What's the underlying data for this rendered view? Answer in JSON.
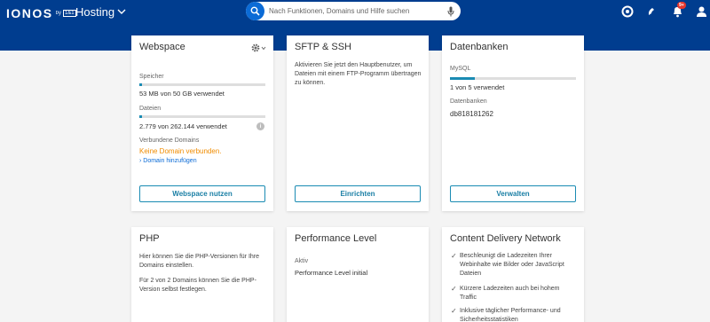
{
  "header": {
    "logo": "IONOS",
    "logo_by": "by",
    "logo_partner": "1&1",
    "product": "Hosting",
    "search_placeholder": "Nach Funktionen, Domains und Hilfe suchen",
    "notification_count": "9+",
    "color": "#003d8f"
  },
  "webspace": {
    "title": "Webspace",
    "storage_label": "Speicher",
    "storage_value": "53 MB von 50 GB verwendet",
    "storage_fraction": 0.001,
    "files_label": "Dateien",
    "files_value": "2.779 von 262.144 verwendet",
    "files_fraction": 0.0106,
    "domains_label": "Verbundene Domains",
    "domains_none": "Keine Domain verbunden.",
    "add_domain": "Domain hinzufügen",
    "button": "Webspace nutzen"
  },
  "sftp": {
    "title": "SFTP & SSH",
    "description": "Aktivieren Sie jetzt den Hauptbenutzer, um Dateien mit einem FTP-Programm übertragen zu können.",
    "button": "Einrichten"
  },
  "databases": {
    "title": "Datenbanken",
    "mysql_label": "MySQL",
    "mysql_value": "1 von 5 verwendet",
    "mysql_fraction": 0.2,
    "db_label": "Datenbanken",
    "db_name": "db818181262",
    "button": "Verwalten"
  },
  "php": {
    "title": "PHP",
    "desc1": "Hier können Sie die PHP-Versionen für Ihre Domains einstellen.",
    "desc2": "Für 2 von 2 Domains können Sie die PHP-Version selbst festlegen."
  },
  "performance": {
    "title": "Performance Level",
    "status_label": "Aktiv",
    "level": "Performance Level initial"
  },
  "cdn": {
    "title": "Content Delivery Network",
    "items": [
      "Beschleunigt die Ladezeiten Ihrer Webinhalte wie Bilder oder JavaScript Dateien",
      "Kürzere Ladezeiten auch bei hohem Traffic",
      "Inklusive täglicher Performance- und Sicherheitsstatistiken"
    ]
  }
}
